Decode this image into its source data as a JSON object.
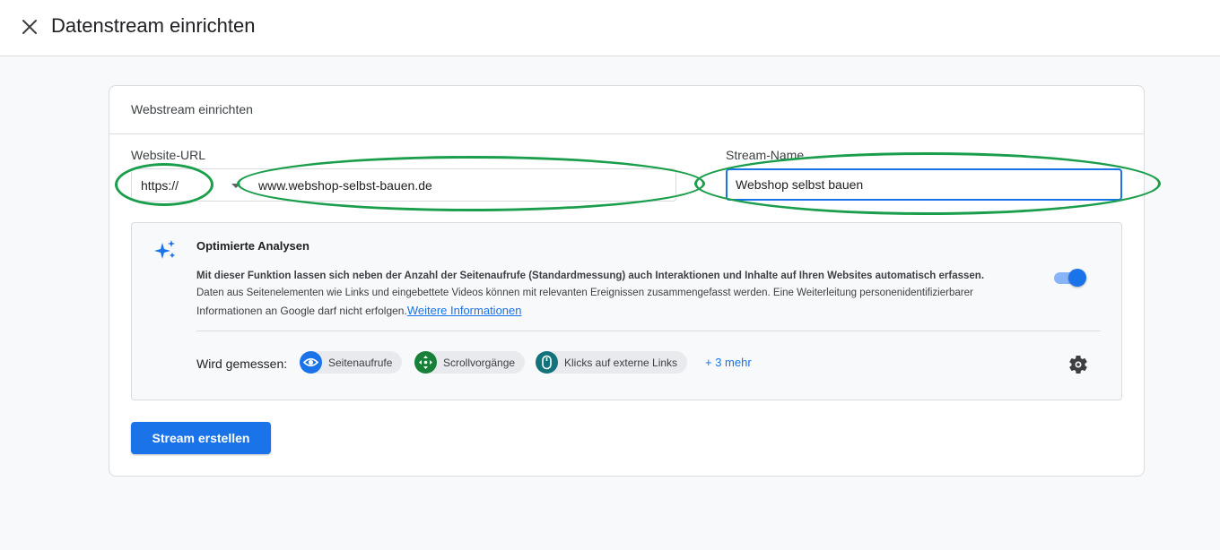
{
  "header": {
    "title": "Datenstream einrichten",
    "close_icon": "close-icon"
  },
  "card": {
    "title": "Webstream einrichten",
    "url_label": "Website-URL",
    "protocol_value": "https://",
    "url_value": "www.webshop-selbst-bauen.de",
    "stream_name_label": "Stream-Name",
    "stream_name_value": "Webshop selbst bauen"
  },
  "analysis": {
    "icon": "sparkle-icon",
    "title": "Optimierte Analysen",
    "line1": "Mit dieser Funktion lassen sich neben der Anzahl der Seitenaufrufe (Standardmessung) auch Interaktionen und Inhalte auf Ihren Websites automatisch erfassen.",
    "line2": "Daten aus Seitenelementen wie Links und eingebettete Videos können mit relevanten Ereignissen zusammengefasst werden. Eine Weiterleitung personenidentifizierbarer",
    "line3": "Informationen an Google darf nicht erfolgen.",
    "link": "Weitere Informationen",
    "toggle_on": true,
    "measured_label": "Wird gemessen:",
    "chips": [
      {
        "label": "Seitenaufrufe",
        "icon": "eye-icon",
        "color": "#1a73e8"
      },
      {
        "label": "Scrollvorgänge",
        "icon": "scroll-arrows-icon",
        "color": "#188038"
      },
      {
        "label": "Klicks auf externe Links",
        "icon": "mouse-icon",
        "color": "#12737b"
      }
    ],
    "more": "+ 3 mehr",
    "settings_icon": "gear-icon"
  },
  "button": {
    "label": "Stream erstellen"
  },
  "colors": {
    "accent": "#1a73e8",
    "annotation": "#1a9e4b"
  }
}
